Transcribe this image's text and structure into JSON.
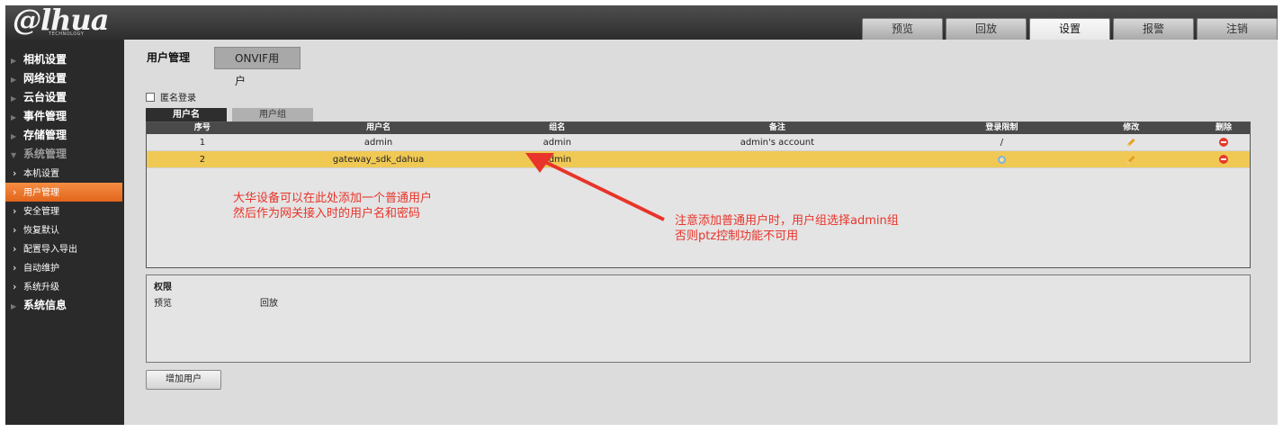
{
  "brand": {
    "logo": "@lhua",
    "sub": "TECHNOLOGY"
  },
  "top_tabs": [
    "预览",
    "回放",
    "设置",
    "报警",
    "注销"
  ],
  "sidebar": {
    "sections": [
      {
        "label": "相机设置"
      },
      {
        "label": "网络设置"
      },
      {
        "label": "云台设置"
      },
      {
        "label": "事件管理"
      },
      {
        "label": "存储管理"
      },
      {
        "label": "系统管理"
      }
    ],
    "sub_items": [
      "本机设置",
      "用户管理",
      "安全管理",
      "恢复默认",
      "配置导入导出",
      "自动维护",
      "系统升级"
    ],
    "last": "系统信息"
  },
  "page_tabs": {
    "user_mgmt": "用户管理",
    "onvif": "ONVIF用户"
  },
  "anonymous_login": "匿名登录",
  "sub_tabs": {
    "username": "用户名",
    "group": "用户组"
  },
  "table": {
    "headers": [
      "序号",
      "用户名",
      "组名",
      "备注",
      "登录限制",
      "修改",
      "删除"
    ],
    "rows": [
      {
        "no": "1",
        "user": "admin",
        "group": "admin",
        "note": "admin's account",
        "limit": "/"
      },
      {
        "no": "2",
        "user": "gateway_sdk_dahua",
        "group": "admin",
        "note": "",
        "limit": ""
      }
    ]
  },
  "permissions": {
    "title": "权限",
    "items": [
      "预览",
      "回放"
    ]
  },
  "add_user": "增加用户",
  "annotations": {
    "note1_line1": "大华设备可以在此处添加一个普通用户",
    "note1_line2": "然后作为网关接入时的用户名和密码",
    "note2_line1": "注意添加普通用户时，用户组选择admin组",
    "note2_line2": "否则ptz控制功能不可用"
  },
  "colors": {
    "accent": "#e8342a",
    "highlight": "#f0c955",
    "active_nav": "#ef7a30"
  }
}
